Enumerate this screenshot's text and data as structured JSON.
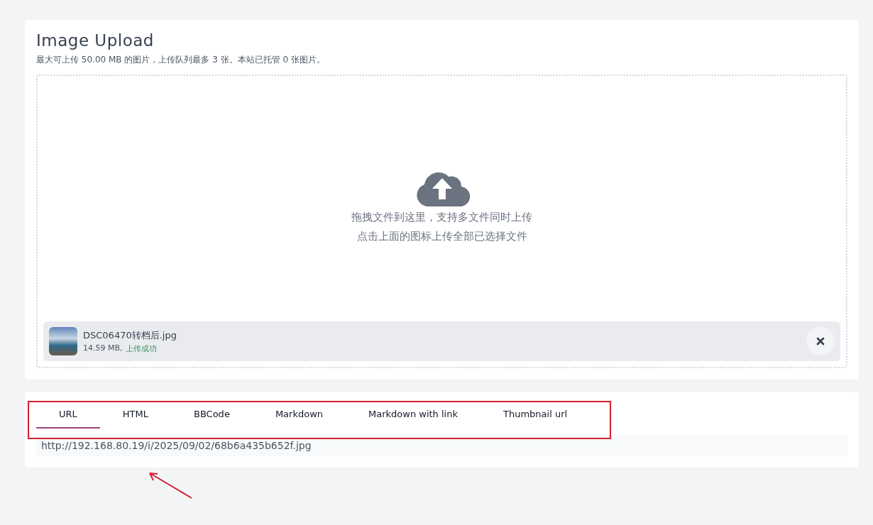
{
  "upload": {
    "title": "Image Upload",
    "subtitle": "最大可上传 50.00 MB 的图片，上传队列最多 3 张。本站已托管 0 张图片。",
    "dropzone": {
      "lines": [
        "拖拽文件到这里，支持多文件同时上传",
        "点击上面的图标上传全部已选择文件"
      ]
    },
    "files": [
      {
        "name": "DSC06470转档后.jpg",
        "size": "14.59 MB,",
        "status": "上传成功"
      }
    ]
  },
  "links": {
    "tabs": [
      {
        "label": "URL",
        "selected": true
      },
      {
        "label": "HTML",
        "selected": false
      },
      {
        "label": "BBCode",
        "selected": false
      },
      {
        "label": "Markdown",
        "selected": false
      },
      {
        "label": "Markdown with link",
        "selected": false
      },
      {
        "label": "Thumbnail url",
        "selected": false
      }
    ],
    "value": "http://192.168.80.19/i/2025/09/02/68b6a435b652f.jpg"
  }
}
